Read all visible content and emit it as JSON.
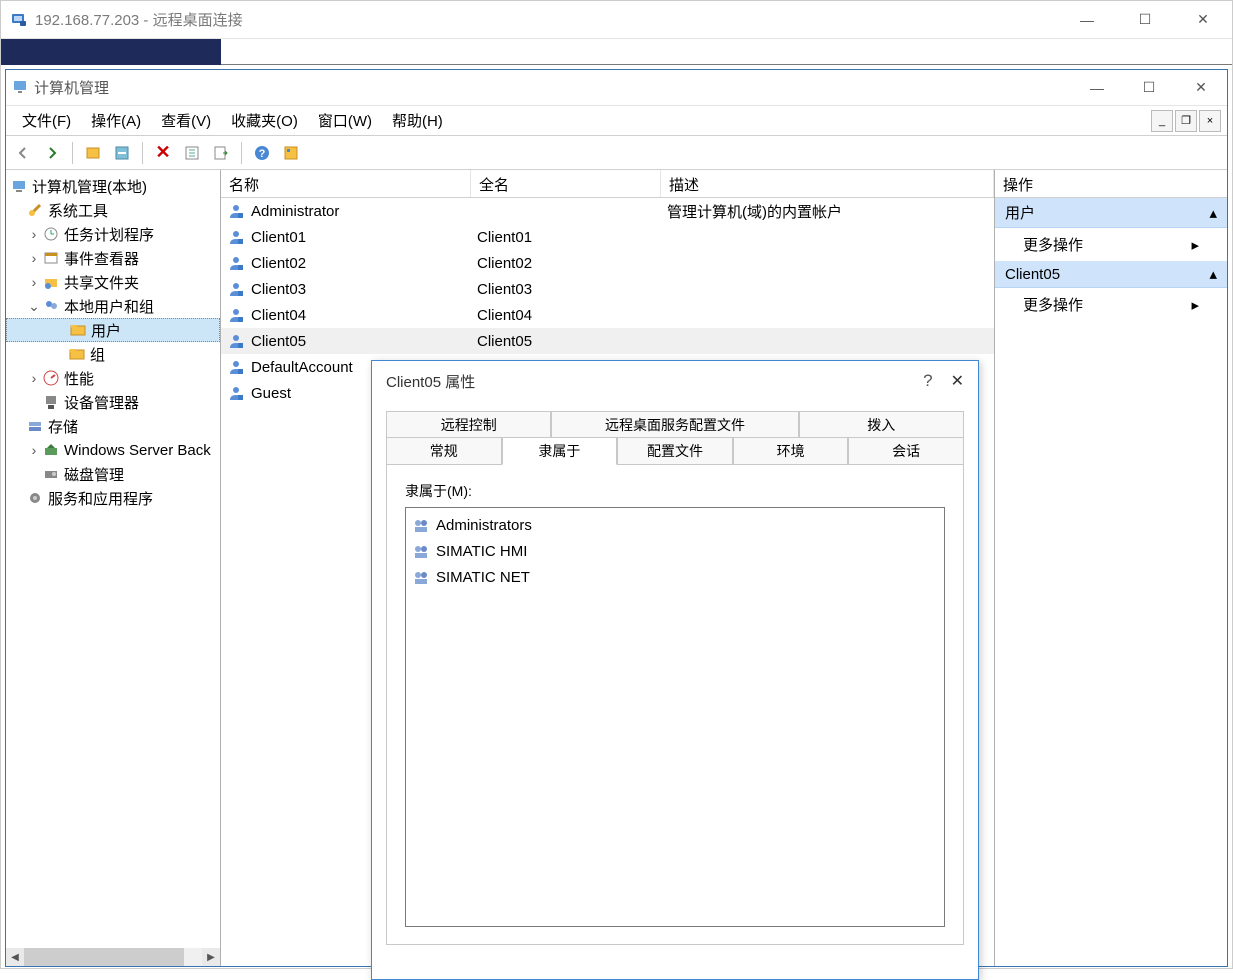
{
  "rdp": {
    "title": "192.168.77.203 - 远程桌面连接"
  },
  "mmc": {
    "title": "计算机管理"
  },
  "menu": {
    "file": "文件(F)",
    "action": "操作(A)",
    "view": "查看(V)",
    "favorites": "收藏夹(O)",
    "window": "窗口(W)",
    "help": "帮助(H)"
  },
  "tree_root": "计算机管理(本地)",
  "tree": {
    "system_tools": "系统工具",
    "task_scheduler": "任务计划程序",
    "event_viewer": "事件查看器",
    "shared_folders": "共享文件夹",
    "local_users_groups": "本地用户和组",
    "users": "用户",
    "groups": "组",
    "performance": "性能",
    "device_manager": "设备管理器",
    "storage": "存储",
    "wsb": "Windows Server Back",
    "disk_mgmt": "磁盘管理",
    "services_apps": "服务和应用程序"
  },
  "list_headers": {
    "name": "名称",
    "fullname": "全名",
    "description": "描述"
  },
  "users": [
    {
      "name": "Administrator",
      "fullname": "",
      "desc": "管理计算机(域)的内置帐户"
    },
    {
      "name": "Client01",
      "fullname": "Client01",
      "desc": ""
    },
    {
      "name": "Client02",
      "fullname": "Client02",
      "desc": ""
    },
    {
      "name": "Client03",
      "fullname": "Client03",
      "desc": ""
    },
    {
      "name": "Client04",
      "fullname": "Client04",
      "desc": ""
    },
    {
      "name": "Client05",
      "fullname": "Client05",
      "desc": ""
    },
    {
      "name": "DefaultAccount",
      "fullname": "",
      "desc": ""
    },
    {
      "name": "Guest",
      "fullname": "",
      "desc": ""
    }
  ],
  "action_pane": {
    "header": "操作",
    "section1": "用户",
    "more": "更多操作",
    "section2": "Client05"
  },
  "dialog": {
    "title": "Client05 属性",
    "tabs_row1": {
      "remote_control": "远程控制",
      "rds_profile": "远程桌面服务配置文件",
      "dialin": "拨入"
    },
    "tabs_row2": {
      "general": "常规",
      "memberof": "隶属于",
      "profile": "配置文件",
      "environment": "环境",
      "sessions": "会话"
    },
    "memberof_label": "隶属于(M):",
    "groups": [
      "Administrators",
      "SIMATIC HMI",
      "SIMATIC NET"
    ]
  }
}
